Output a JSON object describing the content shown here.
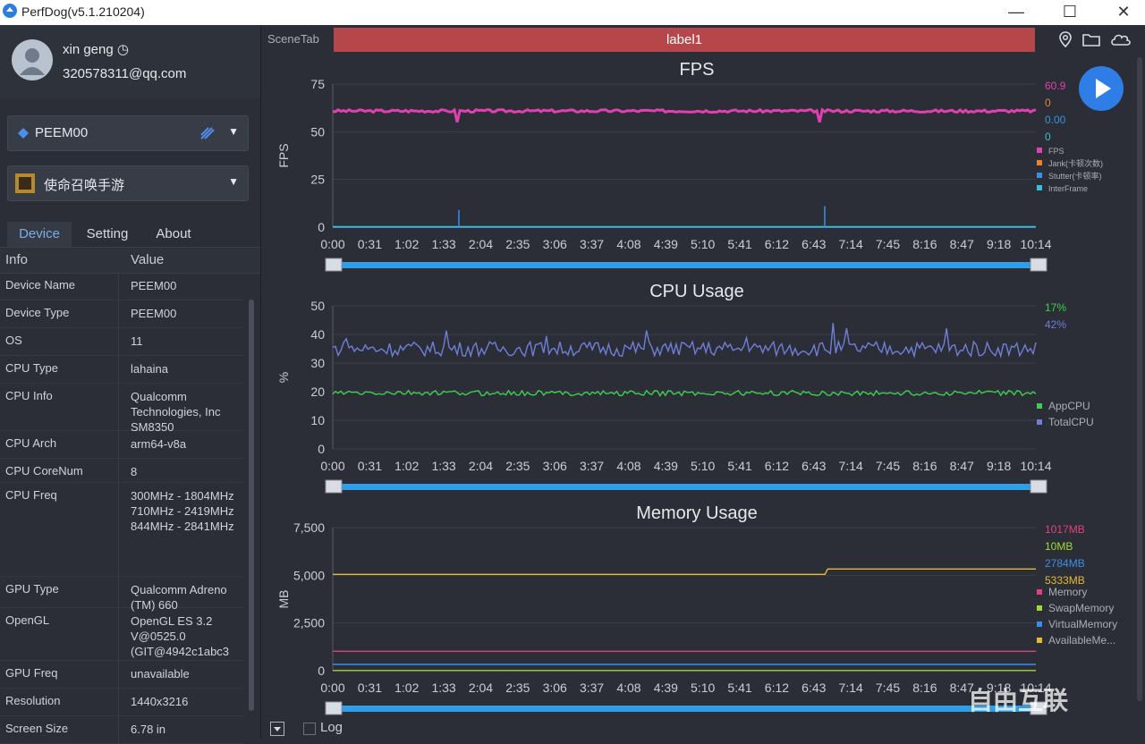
{
  "window": {
    "title": "PerfDog(v5.1.210204)",
    "minimize": "—",
    "maximize": "☐",
    "close": "✕"
  },
  "user": {
    "name": "xin geng ◷",
    "email": "320578311@qq.com"
  },
  "device_dropdown": {
    "value": "PEEM00"
  },
  "app_dropdown": {
    "value": "使命召唤手游"
  },
  "tabs": [
    "Device",
    "Setting",
    "About"
  ],
  "table": {
    "headers": [
      "Info",
      "Value"
    ],
    "rows": [
      {
        "k": "Device Name",
        "v": "PEEM00",
        "h": 30
      },
      {
        "k": "Device Type",
        "v": "PEEM00",
        "h": 30
      },
      {
        "k": "OS",
        "v": "11",
        "h": 30
      },
      {
        "k": "CPU Type",
        "v": "lahaina",
        "h": 30
      },
      {
        "k": "CPU Info",
        "v": "Qualcomm Technologies, Inc SM8350",
        "h": 52
      },
      {
        "k": "CPU Arch",
        "v": "arm64-v8a",
        "h": 30
      },
      {
        "k": "CPU CoreNum",
        "v": "8",
        "h": 26
      },
      {
        "k": "CPU Freq",
        "v": "300MHz - 1804MHz 710MHz - 2419MHz 844MHz - 2841MHz",
        "h": 104
      },
      {
        "k": "GPU Type",
        "v": "Qualcomm Adreno (TM) 660",
        "h": 34
      },
      {
        "k": "OpenGL",
        "v": "OpenGL ES 3.2 V@0525.0 (GIT@4942c1abc3",
        "h": 58
      },
      {
        "k": "GPU Freq",
        "v": "unavailable",
        "h": 30
      },
      {
        "k": "Resolution",
        "v": "1440x3216",
        "h": 30
      },
      {
        "k": "Screen Size",
        "v": "6.78 in",
        "h": 30
      }
    ]
  },
  "scene": {
    "tab_label": "SceneTab",
    "label": "label1"
  },
  "log": {
    "label": "Log"
  },
  "watermark": "自由互联",
  "colors": {
    "accent": "#2f7ee8",
    "label_bar": "#b5474a",
    "fps": "#e040b0",
    "cpu_app": "#3ecf50",
    "cpu_total": "#6f7fd8",
    "mem_available": "#e8b830"
  },
  "time_ticks": [
    "0:00",
    "0:31",
    "1:02",
    "1:33",
    "2:04",
    "2:35",
    "3:06",
    "3:37",
    "4:08",
    "4:39",
    "5:10",
    "5:41",
    "6:12",
    "6:43",
    "7:14",
    "7:45",
    "8:16",
    "8:47",
    "9:18",
    "10:14"
  ],
  "chart_data": [
    {
      "type": "line",
      "title": "FPS",
      "ylabel": "FPS",
      "ylim": [
        0,
        75
      ],
      "yticks": [
        "0",
        "25",
        "50",
        "75"
      ],
      "series": [
        {
          "name": "FPS",
          "value_label": "60.9",
          "color": "#e040b0",
          "level": 60.9
        },
        {
          "name": "Jank(卡顿次数)",
          "value_label": "0",
          "color": "#f08030",
          "level": 0
        },
        {
          "name": "Stutter(卡顿率)",
          "value_label": "0.00",
          "color": "#3a8ee8",
          "level": 0
        },
        {
          "name": "InterFrame",
          "value_label": "0",
          "color": "#36c2d6",
          "level": 0.3
        }
      ]
    },
    {
      "type": "line",
      "title": "CPU Usage",
      "ylabel": "%",
      "ylim": [
        0,
        50
      ],
      "yticks": [
        "0",
        "10",
        "20",
        "30",
        "40",
        "50"
      ],
      "series": [
        {
          "name": "AppCPU",
          "value_label": "17%",
          "color": "#3ecf50",
          "level": 19.5
        },
        {
          "name": "TotalCPU",
          "value_label": "42%",
          "color": "#6f7fd8",
          "level": 35
        }
      ]
    },
    {
      "type": "line",
      "title": "Memory Usage",
      "ylabel": "MB",
      "ylim": [
        0,
        7500
      ],
      "yticks": [
        "0",
        "2,500",
        "5,000",
        "7,500"
      ],
      "series": [
        {
          "name": "Memory",
          "value_label": "1017MB",
          "color": "#e0407c",
          "level": 1017
        },
        {
          "name": "SwapMemory",
          "value_label": "10MB",
          "color": "#a0d838",
          "level": 10
        },
        {
          "name": "VirtualMemory",
          "value_label": "2784MB",
          "color": "#3a8ee8",
          "level": 330
        },
        {
          "name": "AvailableMe...",
          "value_label": "5333MB",
          "color": "#e8b830",
          "level": 5050
        }
      ]
    }
  ]
}
